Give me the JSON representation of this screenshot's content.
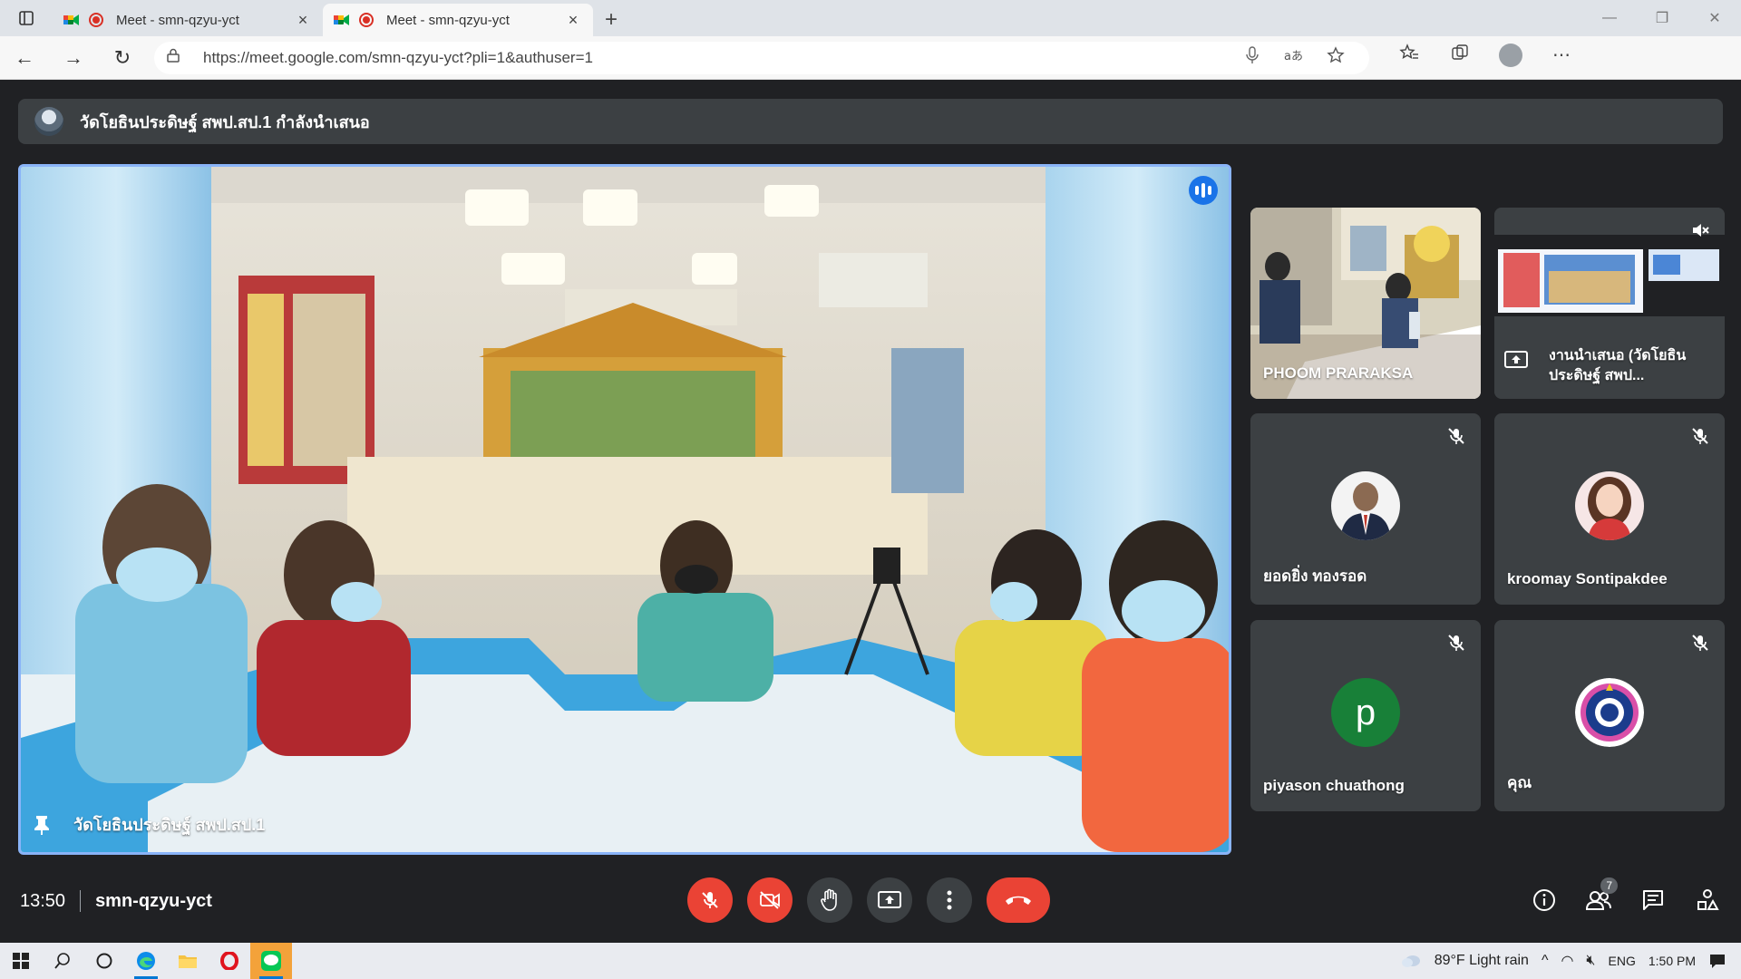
{
  "browser": {
    "tabs": [
      {
        "title": "Meet - smn-qzyu-yct",
        "active": false
      },
      {
        "title": "Meet - smn-qzyu-yct",
        "active": true
      }
    ],
    "url": "https://meet.google.com/smn-qzyu-yct?pli=1&authuser=1"
  },
  "meet": {
    "presenting_banner": "วัดโยธินประดิษฐ์ สพป.สป.1 กำลังนำเสนอ",
    "main_tile": {
      "name": "วัดโยธินประดิษฐ์ สพป.สป.1"
    },
    "tiles": [
      {
        "name": "PHOOM PRARAKSA"
      },
      {
        "name": "งานนำเสนอ (วัดโยธินประดิษฐ์ สพป..."
      },
      {
        "name": "ยอดยิ่ง ทองรอด"
      },
      {
        "name": "kroomay Sontipakdee"
      },
      {
        "name": "piyason chuathong",
        "initial": "p"
      },
      {
        "name": "คุณ"
      }
    ],
    "time": "13:50",
    "meeting_code": "smn-qzyu-yct",
    "participant_count": "7"
  },
  "taskbar": {
    "weather": "89°F  Light rain",
    "language": "ENG",
    "clock": "1:50 PM"
  },
  "colors": {
    "accent": "#8ab4f8",
    "danger": "#ea4335",
    "speaking": "#1a73e8",
    "avatar_p": "#188038"
  }
}
